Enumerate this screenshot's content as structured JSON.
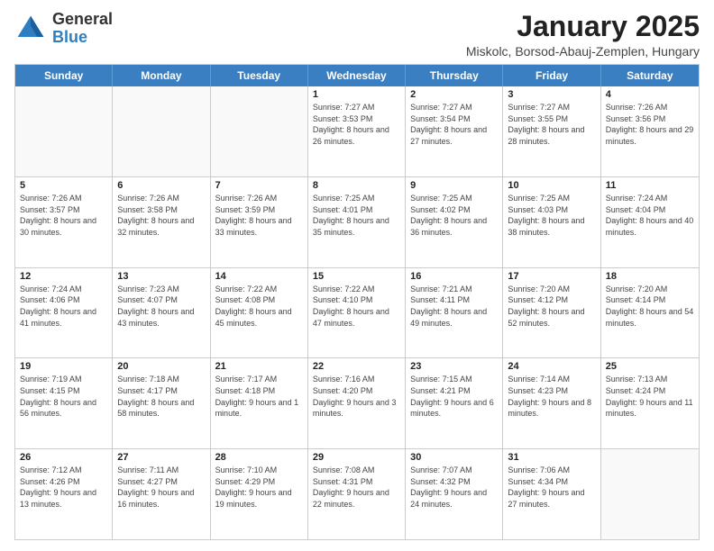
{
  "header": {
    "logo_line1": "General",
    "logo_line2": "Blue",
    "title": "January 2025",
    "subtitle": "Miskolc, Borsod-Abauj-Zemplen, Hungary"
  },
  "days_of_week": [
    "Sunday",
    "Monday",
    "Tuesday",
    "Wednesday",
    "Thursday",
    "Friday",
    "Saturday"
  ],
  "weeks": [
    [
      {
        "day": "",
        "info": ""
      },
      {
        "day": "",
        "info": ""
      },
      {
        "day": "",
        "info": ""
      },
      {
        "day": "1",
        "info": "Sunrise: 7:27 AM\nSunset: 3:53 PM\nDaylight: 8 hours and 26 minutes."
      },
      {
        "day": "2",
        "info": "Sunrise: 7:27 AM\nSunset: 3:54 PM\nDaylight: 8 hours and 27 minutes."
      },
      {
        "day": "3",
        "info": "Sunrise: 7:27 AM\nSunset: 3:55 PM\nDaylight: 8 hours and 28 minutes."
      },
      {
        "day": "4",
        "info": "Sunrise: 7:26 AM\nSunset: 3:56 PM\nDaylight: 8 hours and 29 minutes."
      }
    ],
    [
      {
        "day": "5",
        "info": "Sunrise: 7:26 AM\nSunset: 3:57 PM\nDaylight: 8 hours and 30 minutes."
      },
      {
        "day": "6",
        "info": "Sunrise: 7:26 AM\nSunset: 3:58 PM\nDaylight: 8 hours and 32 minutes."
      },
      {
        "day": "7",
        "info": "Sunrise: 7:26 AM\nSunset: 3:59 PM\nDaylight: 8 hours and 33 minutes."
      },
      {
        "day": "8",
        "info": "Sunrise: 7:25 AM\nSunset: 4:01 PM\nDaylight: 8 hours and 35 minutes."
      },
      {
        "day": "9",
        "info": "Sunrise: 7:25 AM\nSunset: 4:02 PM\nDaylight: 8 hours and 36 minutes."
      },
      {
        "day": "10",
        "info": "Sunrise: 7:25 AM\nSunset: 4:03 PM\nDaylight: 8 hours and 38 minutes."
      },
      {
        "day": "11",
        "info": "Sunrise: 7:24 AM\nSunset: 4:04 PM\nDaylight: 8 hours and 40 minutes."
      }
    ],
    [
      {
        "day": "12",
        "info": "Sunrise: 7:24 AM\nSunset: 4:06 PM\nDaylight: 8 hours and 41 minutes."
      },
      {
        "day": "13",
        "info": "Sunrise: 7:23 AM\nSunset: 4:07 PM\nDaylight: 8 hours and 43 minutes."
      },
      {
        "day": "14",
        "info": "Sunrise: 7:22 AM\nSunset: 4:08 PM\nDaylight: 8 hours and 45 minutes."
      },
      {
        "day": "15",
        "info": "Sunrise: 7:22 AM\nSunset: 4:10 PM\nDaylight: 8 hours and 47 minutes."
      },
      {
        "day": "16",
        "info": "Sunrise: 7:21 AM\nSunset: 4:11 PM\nDaylight: 8 hours and 49 minutes."
      },
      {
        "day": "17",
        "info": "Sunrise: 7:20 AM\nSunset: 4:12 PM\nDaylight: 8 hours and 52 minutes."
      },
      {
        "day": "18",
        "info": "Sunrise: 7:20 AM\nSunset: 4:14 PM\nDaylight: 8 hours and 54 minutes."
      }
    ],
    [
      {
        "day": "19",
        "info": "Sunrise: 7:19 AM\nSunset: 4:15 PM\nDaylight: 8 hours and 56 minutes."
      },
      {
        "day": "20",
        "info": "Sunrise: 7:18 AM\nSunset: 4:17 PM\nDaylight: 8 hours and 58 minutes."
      },
      {
        "day": "21",
        "info": "Sunrise: 7:17 AM\nSunset: 4:18 PM\nDaylight: 9 hours and 1 minute."
      },
      {
        "day": "22",
        "info": "Sunrise: 7:16 AM\nSunset: 4:20 PM\nDaylight: 9 hours and 3 minutes."
      },
      {
        "day": "23",
        "info": "Sunrise: 7:15 AM\nSunset: 4:21 PM\nDaylight: 9 hours and 6 minutes."
      },
      {
        "day": "24",
        "info": "Sunrise: 7:14 AM\nSunset: 4:23 PM\nDaylight: 9 hours and 8 minutes."
      },
      {
        "day": "25",
        "info": "Sunrise: 7:13 AM\nSunset: 4:24 PM\nDaylight: 9 hours and 11 minutes."
      }
    ],
    [
      {
        "day": "26",
        "info": "Sunrise: 7:12 AM\nSunset: 4:26 PM\nDaylight: 9 hours and 13 minutes."
      },
      {
        "day": "27",
        "info": "Sunrise: 7:11 AM\nSunset: 4:27 PM\nDaylight: 9 hours and 16 minutes."
      },
      {
        "day": "28",
        "info": "Sunrise: 7:10 AM\nSunset: 4:29 PM\nDaylight: 9 hours and 19 minutes."
      },
      {
        "day": "29",
        "info": "Sunrise: 7:08 AM\nSunset: 4:31 PM\nDaylight: 9 hours and 22 minutes."
      },
      {
        "day": "30",
        "info": "Sunrise: 7:07 AM\nSunset: 4:32 PM\nDaylight: 9 hours and 24 minutes."
      },
      {
        "day": "31",
        "info": "Sunrise: 7:06 AM\nSunset: 4:34 PM\nDaylight: 9 hours and 27 minutes."
      },
      {
        "day": "",
        "info": ""
      }
    ]
  ]
}
